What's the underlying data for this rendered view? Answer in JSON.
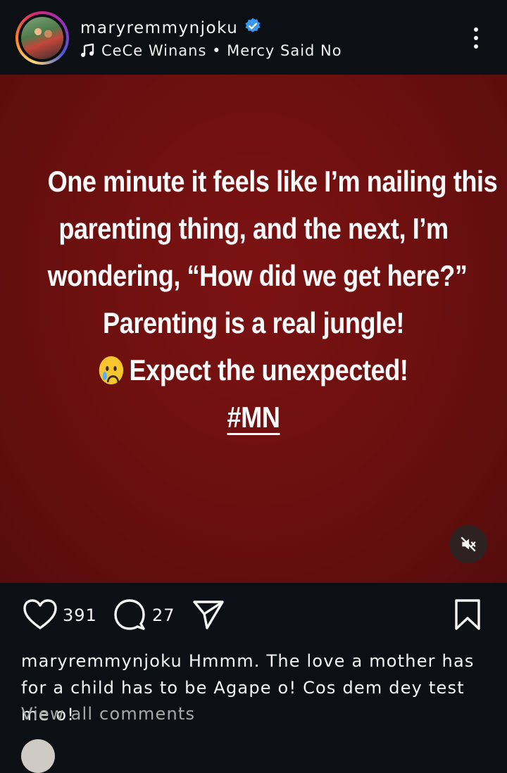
{
  "post": {
    "username": "maryremmynjoku",
    "music": "CeCe Winans • Mercy Said No"
  },
  "story": {
    "lines": [
      "One minute it feels like I’m nailing this",
      "parenting thing, and the next, I’m",
      "wondering, “How did we get here?”",
      "Parenting is a real jungle!",
      "Expect the unexpected!"
    ],
    "hashtag": "#MN"
  },
  "stats": {
    "likes": "391",
    "comments": "27"
  },
  "caption": {
    "username": "maryremmynjoku",
    "text": "Hmmm. The love a mother has for a child has to be Agape o! Cos dem dey test me o!"
  },
  "view_all": "View all comments",
  "colors": {
    "background": "#0c1014",
    "story_red": "#6a0f0f",
    "verified_blue": "#3897f0"
  }
}
